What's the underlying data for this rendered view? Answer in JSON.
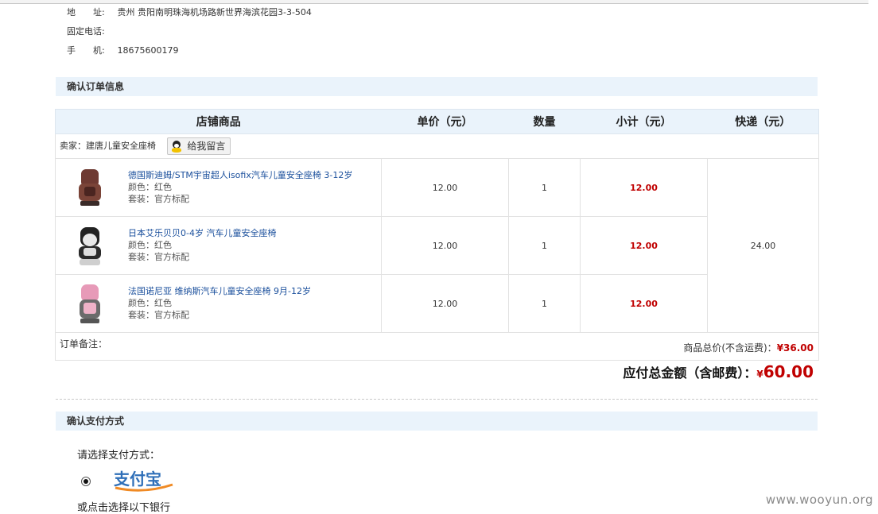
{
  "address_block": {
    "address_label": "地　　址:",
    "address_value": "贵州 贵阳南明珠海机场路新世界海滨花园3-3-504",
    "phone_label": "固定电话:",
    "phone_value": "",
    "mobile_label": "手　　机:",
    "mobile_value": "18675600179"
  },
  "order_section": {
    "title": "确认订单信息"
  },
  "table": {
    "headers": [
      "店铺商品",
      "单价（元）",
      "数量",
      "小计（元）",
      "快递（元）"
    ],
    "seller_label": "卖家：建唐儿童安全座椅",
    "message_button": "给我留言",
    "rows": [
      {
        "name": "德国斯迪姆/STM宇宙超人isofix汽车儿童安全座椅 3-12岁",
        "color": "颜色：红色",
        "package": "套装：官方标配",
        "price": "12.00",
        "qty": "1",
        "subtotal": "12.00"
      },
      {
        "name": "日本艾乐贝贝0-4岁 汽车儿童安全座椅",
        "color": "颜色：红色",
        "package": "套装：官方标配",
        "price": "12.00",
        "qty": "1",
        "subtotal": "12.00"
      },
      {
        "name": "法国诺尼亚 维纳斯汽车儿童安全座椅 9月-12岁",
        "color": "颜色：红色",
        "package": "套装：官方标配",
        "price": "12.00",
        "qty": "1",
        "subtotal": "12.00"
      }
    ],
    "shipping": "24.00",
    "remark_label": "订单备注：",
    "goods_total_label": "商品总价(不含运费)：",
    "goods_total_value": "¥36.00"
  },
  "grand_total": {
    "label": "应付总金额（含邮费）：",
    "currency": "¥",
    "value": "60.00"
  },
  "payment_section": {
    "title": "确认支付方式",
    "prompt": "请选择支付方式：",
    "option": "支付宝",
    "bank_prompt": "或点击选择以下银行"
  },
  "watermark": "www.wooyun.org",
  "colors": {
    "accent_red": "#c00000",
    "header_bg": "#eaf3fb",
    "link_blue": "#1a4f9c"
  }
}
